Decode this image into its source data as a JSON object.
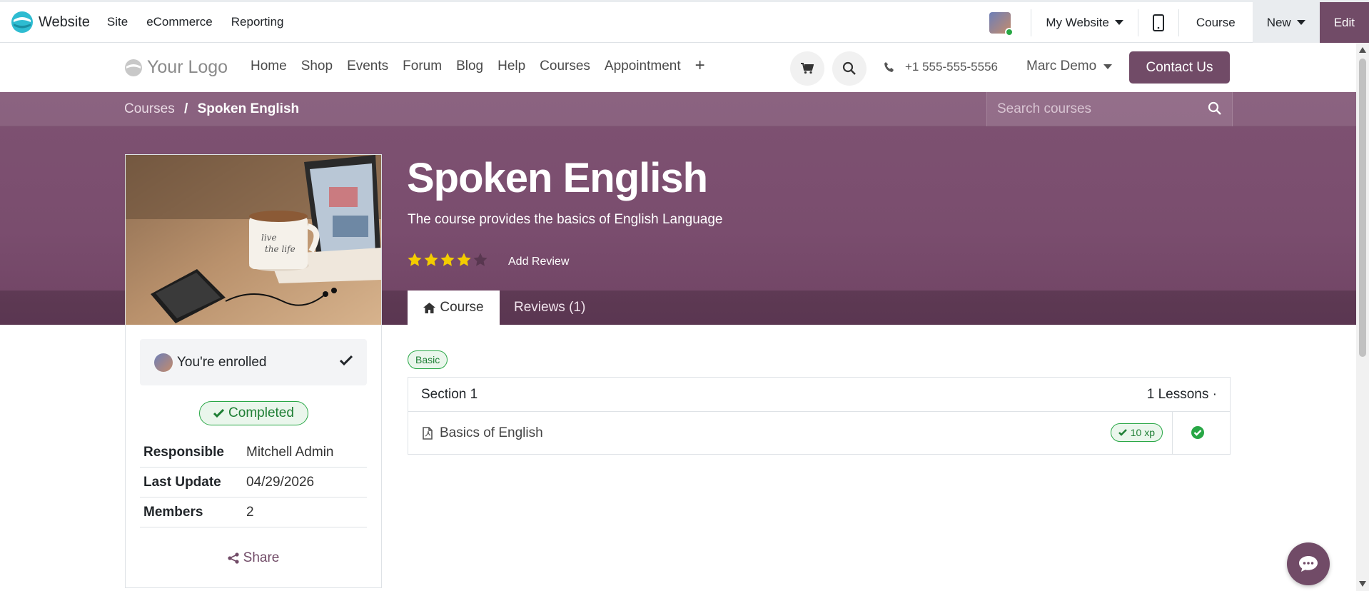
{
  "topbar": {
    "app_name": "Website",
    "menu": [
      "Site",
      "eCommerce",
      "Reporting"
    ],
    "my_website": "My Website",
    "course": "Course",
    "new": "New",
    "edit": "Edit"
  },
  "site": {
    "logo_text": "Your Logo",
    "menu": [
      "Home",
      "Shop",
      "Events",
      "Forum",
      "Blog",
      "Help",
      "Courses",
      "Appointment"
    ],
    "phone": "+1 555-555-5556",
    "user": "Marc Demo",
    "contact": "Contact Us"
  },
  "breadcrumb": {
    "parent": "Courses",
    "separator": "/",
    "current": "Spoken English"
  },
  "search": {
    "placeholder": "Search courses"
  },
  "course": {
    "title": "Spoken English",
    "subtitle": "The course provides the basics of English Language",
    "rating_filled": 4,
    "rating_max": 5,
    "add_review": "Add Review",
    "tabs": {
      "course": "Course",
      "reviews": "Reviews (1)"
    }
  },
  "sidebar": {
    "enrolled": "You're enrolled",
    "completed": "Completed",
    "info": [
      {
        "key": "Responsible",
        "value": "Mitchell Admin"
      },
      {
        "key": "Last Update",
        "value": "04/29/2026"
      },
      {
        "key": "Members",
        "value": "2"
      }
    ],
    "share": "Share"
  },
  "content": {
    "tag": "Basic",
    "section": {
      "title": "Section 1",
      "count": "1 Lessons ·"
    },
    "lesson": {
      "name": "Basics of English",
      "xp": "10 xp"
    }
  },
  "colors": {
    "brand": "#714b67",
    "success": "#28a745",
    "star": "#f3cc00"
  }
}
